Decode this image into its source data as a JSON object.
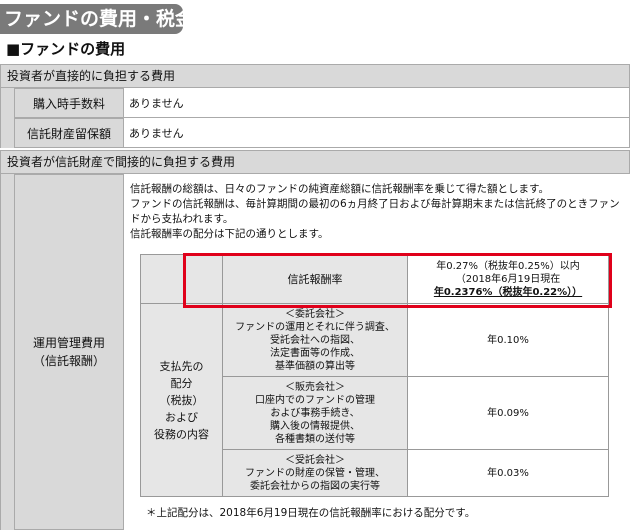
{
  "page_title": "ファンドの費用・税金",
  "section_title": "■ファンドの費用",
  "direct": {
    "header": "投資者が直接的に負担する費用",
    "rows": [
      {
        "label": "購入時手数料",
        "value": "ありません"
      },
      {
        "label": "信託財産留保額",
        "value": "ありません"
      }
    ]
  },
  "indirect": {
    "header": "投資者が信託財産で間接的に負担する費用",
    "label_line1": "運用管理費用",
    "label_line2": "（信託報酬）",
    "paragraph": [
      "信託報酬の総額は、日々のファンドの純資産総額に信託報酬率を乗じて得た額とします。",
      "ファンドの信託報酬は、毎計算期間の最初の6ヵ月終了日および毎計算期末または信託終了のときファン",
      "ドから支払われます。",
      "信託報酬率の配分は下記の通りとします。"
    ],
    "table": {
      "rate_label": "信託報酬率",
      "rate_line1": "年0.27%（税抜年0.25%）以内",
      "rate_line2": "（2018年6月19日現在",
      "rate_line3": "年0.2376%（税抜年0.22%））",
      "left_label": [
        "支払先の",
        "配分",
        "（税抜）",
        "および",
        "役務の内容"
      ],
      "rows": [
        {
          "title": "＜委託会社＞",
          "lines": [
            "ファンドの運用とそれに伴う調査、",
            "受託会社への指図、",
            "法定書面等の作成、",
            "基準価額の算出等"
          ],
          "rate": "年0.10%"
        },
        {
          "title": "＜販売会社＞",
          "lines": [
            "口座内でのファンドの管理",
            "および事務手続き、",
            "購入後の情報提供、",
            "各種書類の送付等"
          ],
          "rate": "年0.09%"
        },
        {
          "title": "＜受託会社＞",
          "lines": [
            "ファンドの財産の保管・管理、",
            "委託会社からの指図の実行等"
          ],
          "rate": "年0.03%"
        }
      ]
    },
    "note": "＊上記配分は、2018年6月19日現在の信託報酬率における配分です。"
  }
}
